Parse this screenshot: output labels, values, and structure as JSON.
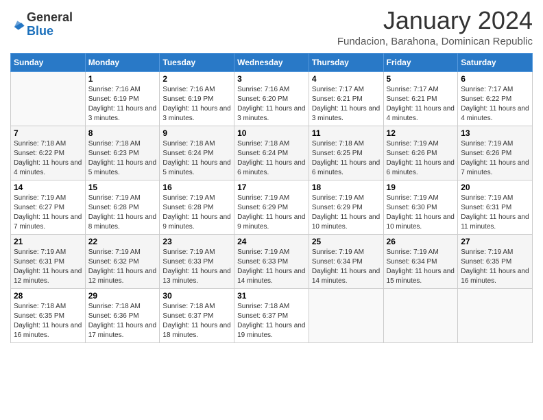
{
  "header": {
    "logo_general": "General",
    "logo_blue": "Blue",
    "month": "January 2024",
    "location": "Fundacion, Barahona, Dominican Republic"
  },
  "days_of_week": [
    "Sunday",
    "Monday",
    "Tuesday",
    "Wednesday",
    "Thursday",
    "Friday",
    "Saturday"
  ],
  "weeks": [
    [
      {
        "day": "",
        "sunrise": "",
        "sunset": "",
        "daylight": ""
      },
      {
        "day": "1",
        "sunrise": "Sunrise: 7:16 AM",
        "sunset": "Sunset: 6:19 PM",
        "daylight": "Daylight: 11 hours and 3 minutes."
      },
      {
        "day": "2",
        "sunrise": "Sunrise: 7:16 AM",
        "sunset": "Sunset: 6:19 PM",
        "daylight": "Daylight: 11 hours and 3 minutes."
      },
      {
        "day": "3",
        "sunrise": "Sunrise: 7:16 AM",
        "sunset": "Sunset: 6:20 PM",
        "daylight": "Daylight: 11 hours and 3 minutes."
      },
      {
        "day": "4",
        "sunrise": "Sunrise: 7:17 AM",
        "sunset": "Sunset: 6:21 PM",
        "daylight": "Daylight: 11 hours and 3 minutes."
      },
      {
        "day": "5",
        "sunrise": "Sunrise: 7:17 AM",
        "sunset": "Sunset: 6:21 PM",
        "daylight": "Daylight: 11 hours and 4 minutes."
      },
      {
        "day": "6",
        "sunrise": "Sunrise: 7:17 AM",
        "sunset": "Sunset: 6:22 PM",
        "daylight": "Daylight: 11 hours and 4 minutes."
      }
    ],
    [
      {
        "day": "7",
        "sunrise": "Sunrise: 7:18 AM",
        "sunset": "Sunset: 6:22 PM",
        "daylight": "Daylight: 11 hours and 4 minutes."
      },
      {
        "day": "8",
        "sunrise": "Sunrise: 7:18 AM",
        "sunset": "Sunset: 6:23 PM",
        "daylight": "Daylight: 11 hours and 5 minutes."
      },
      {
        "day": "9",
        "sunrise": "Sunrise: 7:18 AM",
        "sunset": "Sunset: 6:24 PM",
        "daylight": "Daylight: 11 hours and 5 minutes."
      },
      {
        "day": "10",
        "sunrise": "Sunrise: 7:18 AM",
        "sunset": "Sunset: 6:24 PM",
        "daylight": "Daylight: 11 hours and 6 minutes."
      },
      {
        "day": "11",
        "sunrise": "Sunrise: 7:18 AM",
        "sunset": "Sunset: 6:25 PM",
        "daylight": "Daylight: 11 hours and 6 minutes."
      },
      {
        "day": "12",
        "sunrise": "Sunrise: 7:19 AM",
        "sunset": "Sunset: 6:26 PM",
        "daylight": "Daylight: 11 hours and 6 minutes."
      },
      {
        "day": "13",
        "sunrise": "Sunrise: 7:19 AM",
        "sunset": "Sunset: 6:26 PM",
        "daylight": "Daylight: 11 hours and 7 minutes."
      }
    ],
    [
      {
        "day": "14",
        "sunrise": "Sunrise: 7:19 AM",
        "sunset": "Sunset: 6:27 PM",
        "daylight": "Daylight: 11 hours and 7 minutes."
      },
      {
        "day": "15",
        "sunrise": "Sunrise: 7:19 AM",
        "sunset": "Sunset: 6:28 PM",
        "daylight": "Daylight: 11 hours and 8 minutes."
      },
      {
        "day": "16",
        "sunrise": "Sunrise: 7:19 AM",
        "sunset": "Sunset: 6:28 PM",
        "daylight": "Daylight: 11 hours and 9 minutes."
      },
      {
        "day": "17",
        "sunrise": "Sunrise: 7:19 AM",
        "sunset": "Sunset: 6:29 PM",
        "daylight": "Daylight: 11 hours and 9 minutes."
      },
      {
        "day": "18",
        "sunrise": "Sunrise: 7:19 AM",
        "sunset": "Sunset: 6:29 PM",
        "daylight": "Daylight: 11 hours and 10 minutes."
      },
      {
        "day": "19",
        "sunrise": "Sunrise: 7:19 AM",
        "sunset": "Sunset: 6:30 PM",
        "daylight": "Daylight: 11 hours and 10 minutes."
      },
      {
        "day": "20",
        "sunrise": "Sunrise: 7:19 AM",
        "sunset": "Sunset: 6:31 PM",
        "daylight": "Daylight: 11 hours and 11 minutes."
      }
    ],
    [
      {
        "day": "21",
        "sunrise": "Sunrise: 7:19 AM",
        "sunset": "Sunset: 6:31 PM",
        "daylight": "Daylight: 11 hours and 12 minutes."
      },
      {
        "day": "22",
        "sunrise": "Sunrise: 7:19 AM",
        "sunset": "Sunset: 6:32 PM",
        "daylight": "Daylight: 11 hours and 12 minutes."
      },
      {
        "day": "23",
        "sunrise": "Sunrise: 7:19 AM",
        "sunset": "Sunset: 6:33 PM",
        "daylight": "Daylight: 11 hours and 13 minutes."
      },
      {
        "day": "24",
        "sunrise": "Sunrise: 7:19 AM",
        "sunset": "Sunset: 6:33 PM",
        "daylight": "Daylight: 11 hours and 14 minutes."
      },
      {
        "day": "25",
        "sunrise": "Sunrise: 7:19 AM",
        "sunset": "Sunset: 6:34 PM",
        "daylight": "Daylight: 11 hours and 14 minutes."
      },
      {
        "day": "26",
        "sunrise": "Sunrise: 7:19 AM",
        "sunset": "Sunset: 6:34 PM",
        "daylight": "Daylight: 11 hours and 15 minutes."
      },
      {
        "day": "27",
        "sunrise": "Sunrise: 7:19 AM",
        "sunset": "Sunset: 6:35 PM",
        "daylight": "Daylight: 11 hours and 16 minutes."
      }
    ],
    [
      {
        "day": "28",
        "sunrise": "Sunrise: 7:18 AM",
        "sunset": "Sunset: 6:35 PM",
        "daylight": "Daylight: 11 hours and 16 minutes."
      },
      {
        "day": "29",
        "sunrise": "Sunrise: 7:18 AM",
        "sunset": "Sunset: 6:36 PM",
        "daylight": "Daylight: 11 hours and 17 minutes."
      },
      {
        "day": "30",
        "sunrise": "Sunrise: 7:18 AM",
        "sunset": "Sunset: 6:37 PM",
        "daylight": "Daylight: 11 hours and 18 minutes."
      },
      {
        "day": "31",
        "sunrise": "Sunrise: 7:18 AM",
        "sunset": "Sunset: 6:37 PM",
        "daylight": "Daylight: 11 hours and 19 minutes."
      },
      {
        "day": "",
        "sunrise": "",
        "sunset": "",
        "daylight": ""
      },
      {
        "day": "",
        "sunrise": "",
        "sunset": "",
        "daylight": ""
      },
      {
        "day": "",
        "sunrise": "",
        "sunset": "",
        "daylight": ""
      }
    ]
  ]
}
